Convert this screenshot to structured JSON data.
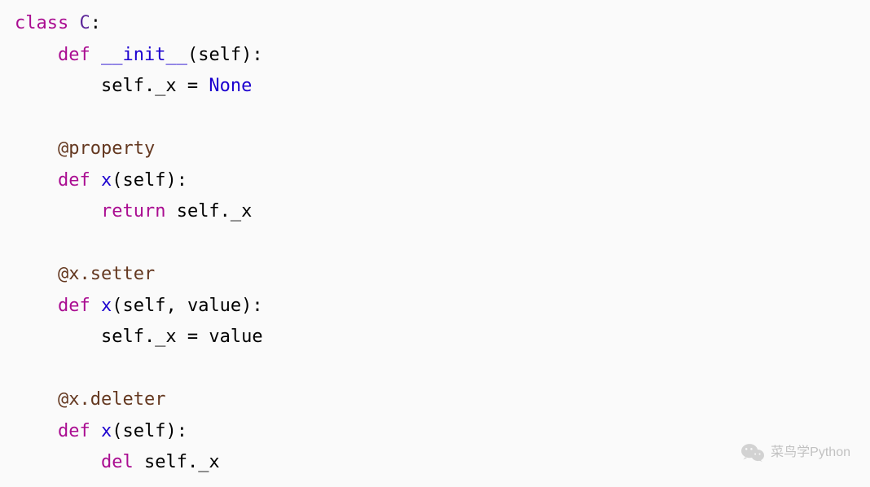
{
  "code": {
    "tokens": [
      [
        [
          "kw",
          "class"
        ],
        [
          "txt",
          " "
        ],
        [
          "cls",
          "C"
        ],
        [
          "txt",
          ":"
        ]
      ],
      [
        [
          "txt",
          "    "
        ],
        [
          "kw",
          "def"
        ],
        [
          "txt",
          " "
        ],
        [
          "fn",
          "__init__"
        ],
        [
          "txt",
          "(self):"
        ]
      ],
      [
        [
          "txt",
          "        self._x "
        ],
        [
          "op",
          "="
        ],
        [
          "txt",
          " "
        ],
        [
          "none",
          "None"
        ]
      ],
      [],
      [
        [
          "txt",
          "    "
        ],
        [
          "dec",
          "@property"
        ]
      ],
      [
        [
          "txt",
          "    "
        ],
        [
          "kw",
          "def"
        ],
        [
          "txt",
          " "
        ],
        [
          "fn",
          "x"
        ],
        [
          "txt",
          "(self):"
        ]
      ],
      [
        [
          "txt",
          "        "
        ],
        [
          "kw",
          "return"
        ],
        [
          "txt",
          " self._x"
        ]
      ],
      [],
      [
        [
          "txt",
          "    "
        ],
        [
          "dec",
          "@x.setter"
        ]
      ],
      [
        [
          "txt",
          "    "
        ],
        [
          "kw",
          "def"
        ],
        [
          "txt",
          " "
        ],
        [
          "fn",
          "x"
        ],
        [
          "txt",
          "(self, value):"
        ]
      ],
      [
        [
          "txt",
          "        self._x "
        ],
        [
          "op",
          "="
        ],
        [
          "txt",
          " value"
        ]
      ],
      [],
      [
        [
          "txt",
          "    "
        ],
        [
          "dec",
          "@x.deleter"
        ]
      ],
      [
        [
          "txt",
          "    "
        ],
        [
          "kw",
          "def"
        ],
        [
          "txt",
          " "
        ],
        [
          "fn",
          "x"
        ],
        [
          "txt",
          "(self):"
        ]
      ],
      [
        [
          "txt",
          "        "
        ],
        [
          "kw",
          "del"
        ],
        [
          "txt",
          " self._x"
        ]
      ]
    ]
  },
  "watermark": {
    "text": "菜鸟学Python"
  }
}
